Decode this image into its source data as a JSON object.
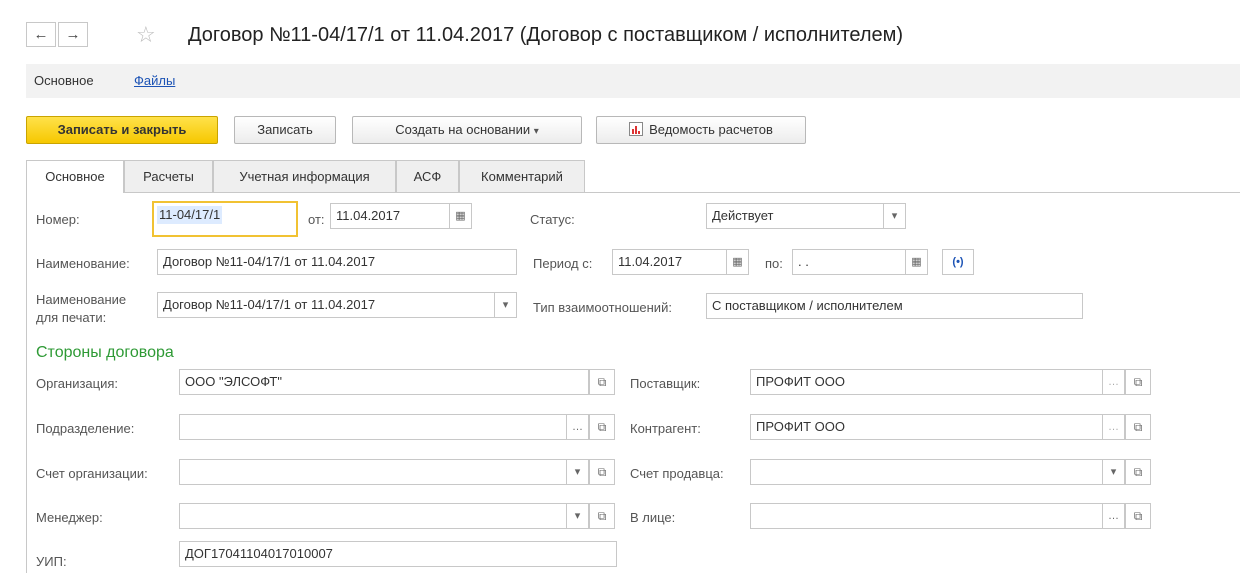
{
  "header": {
    "title": "Договор №11-04/17/1 от 11.04.2017 (Договор с поставщиком / исполнителем)",
    "back_glyph": "←",
    "forward_glyph": "→",
    "star_glyph": "☆"
  },
  "panel": {
    "main": "Основное",
    "files": "Файлы"
  },
  "toolbar": {
    "save_close": "Записать и закрыть",
    "save": "Записать",
    "create_based": "Создать на основании",
    "report": "Ведомость расчетов"
  },
  "tabs": [
    "Основное",
    "Расчеты",
    "Учетная информация",
    "АСФ",
    "Комментарий"
  ],
  "form": {
    "number_label": "Номер:",
    "number_value": "11-04/17/1",
    "from_label": "от:",
    "from_value": "11.04.2017",
    "status_label": "Статус:",
    "status_value": "Действует",
    "name_label": "Наименование:",
    "name_value": "Договор №11-04/17/1 от 11.04.2017",
    "period_label": "Период с:",
    "period_from": "11.04.2017",
    "period_to_label": "по:",
    "period_to": " .  .",
    "print_name_label_1": "Наименование",
    "print_name_label_2": "для печати:",
    "print_name_value": "Договор №11-04/17/1 от 11.04.2017",
    "relation_label": "Тип взаимоотношений:",
    "relation_value": "С поставщиком / исполнителем"
  },
  "parties": {
    "section_title": "Стороны договора",
    "org_label": "Организация:",
    "org_value": "ООО \"ЭЛСОФТ\"",
    "dept_label": "Подразделение:",
    "dept_value": "",
    "org_account_label": "Счет организации:",
    "org_account_value": "",
    "manager_label": "Менеджер:",
    "manager_value": "",
    "uip_label": "УИП:",
    "uip_value": "ДОГ17041104017010007",
    "supplier_label": "Поставщик:",
    "supplier_value": "ПРОФИТ ООО",
    "counterparty_label": "Контрагент:",
    "counterparty_value": "ПРОФИТ ООО",
    "seller_account_label": "Счет продавца:",
    "seller_account_value": "",
    "person_label": "В лице:",
    "person_value": ""
  }
}
